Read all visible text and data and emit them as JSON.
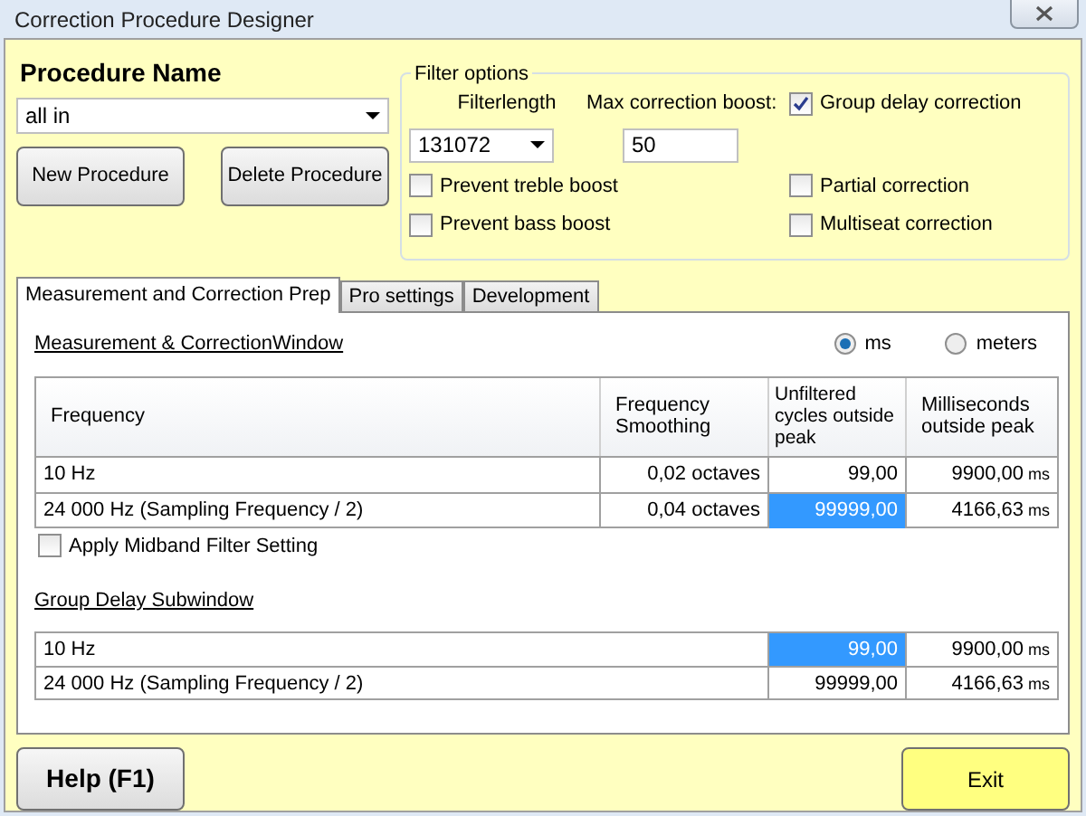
{
  "window": {
    "title": "Correction Procedure Designer"
  },
  "procedure": {
    "label": "Procedure Name",
    "value": "all in"
  },
  "procedure_buttons": [
    "New Procedure",
    "Delete Procedure"
  ],
  "filter_options": {
    "title": "Filter options",
    "filterlength_label": "Filterlength",
    "filterlength_value": "131072",
    "boost_label": "Max correction boost:",
    "boost_value": "50",
    "checkboxes": [
      {
        "label": "Group delay correction",
        "checked": true
      },
      {
        "label": "Prevent treble boost",
        "checked": false
      },
      {
        "label": "Partial correction",
        "checked": false
      },
      {
        "label": "Prevent bass boost",
        "checked": false
      },
      {
        "label": "Multiseat correction",
        "checked": false
      }
    ]
  },
  "tabs": [
    {
      "label": "Measurement and Correction Prep",
      "selected": true
    },
    {
      "label": "Pro settings",
      "selected": false
    },
    {
      "label": "Development",
      "selected": false
    }
  ],
  "section_title": "Measurement & CorrectionWindow",
  "units": [
    {
      "label": "ms",
      "selected": true
    },
    {
      "label": "meters",
      "selected": false
    }
  ],
  "table": {
    "columns": [
      "Frequency",
      "Frequency Smoothing",
      "Unfiltered cycles outside peak",
      "Milliseconds outside peak"
    ],
    "rows": [
      {
        "frequency": "10 Hz",
        "smoothing": "0,02 octaves",
        "cycles": "99,00",
        "cycles_selected": false,
        "ms": "9900,00",
        "unit": "ms"
      },
      {
        "frequency": "24 000 Hz (Sampling Frequency / 2)",
        "smoothing": "0,04 octaves",
        "cycles": "99999,00",
        "cycles_selected": true,
        "ms": "4166,63",
        "unit": "ms"
      }
    ]
  },
  "midband": {
    "label": "Apply Midband Filter Setting",
    "checked": false
  },
  "group_delay": {
    "title": "Group Delay Subwindow",
    "rows": [
      {
        "frequency": "10 Hz",
        "cycles": "99,00",
        "cycles_selected": true,
        "ms": "9900,00",
        "unit": "ms"
      },
      {
        "frequency": "24 000 Hz (Sampling Frequency / 2)",
        "cycles": "99999,00",
        "cycles_selected": false,
        "ms": "4166,63",
        "unit": "ms"
      }
    ]
  },
  "footer_buttons": {
    "help": "Help (F1)",
    "exit": "Exit"
  }
}
